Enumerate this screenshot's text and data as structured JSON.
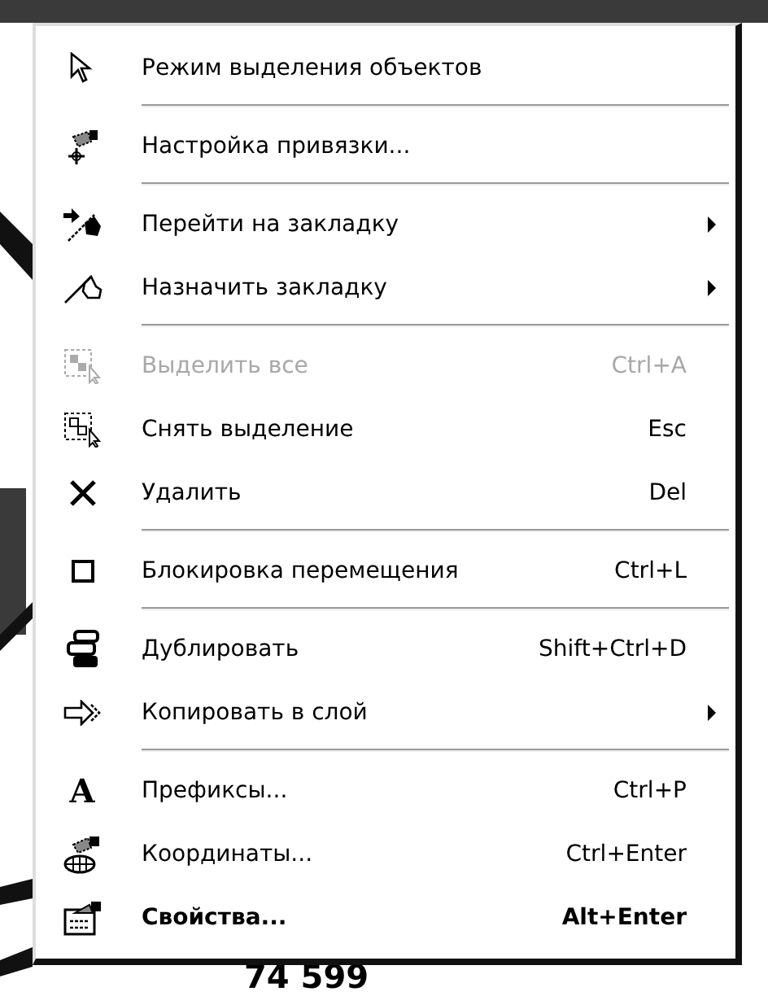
{
  "canvas": {
    "label": "74 599"
  },
  "context_menu": {
    "groups": [
      [
        {
          "label": "Режим выделения объектов",
          "disabled": false
        }
      ],
      [
        {
          "label": "Настройка привязки...",
          "disabled": false
        }
      ],
      [
        {
          "label": "Перейти на закладку",
          "disabled": false,
          "submenu": true
        },
        {
          "label": "Назначить закладку",
          "disabled": false,
          "submenu": true
        }
      ],
      [
        {
          "label": "Выделить все",
          "shortcut": "Ctrl+A",
          "disabled": true
        },
        {
          "label": "Снять выделение",
          "shortcut": "Esc",
          "disabled": false
        },
        {
          "label": "Удалить",
          "shortcut": "Del",
          "disabled": false
        }
      ],
      [
        {
          "label": "Блокировка перемещения",
          "shortcut": "Ctrl+L",
          "disabled": false,
          "checked": false
        }
      ],
      [
        {
          "label": "Дублировать",
          "shortcut": "Shift+Ctrl+D",
          "disabled": false
        },
        {
          "label": "Копировать в слой",
          "disabled": false,
          "submenu": true
        }
      ],
      [
        {
          "label": "Префиксы...",
          "shortcut": "Ctrl+P",
          "disabled": false,
          "icon_text": "A"
        },
        {
          "label": "Координаты...",
          "shortcut": "Ctrl+Enter",
          "disabled": false
        },
        {
          "label": "Свойства...",
          "shortcut": "Alt+Enter",
          "disabled": false,
          "default": true
        }
      ]
    ]
  }
}
